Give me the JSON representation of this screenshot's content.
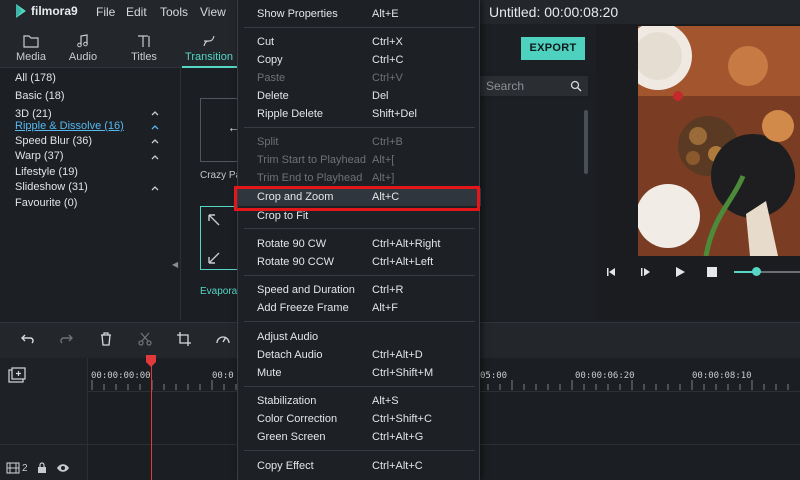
{
  "app": {
    "name": "filmora9",
    "project_title": "Untitled:",
    "project_time": "00:00:08:20"
  },
  "menubar": {
    "items": [
      "File",
      "Edit",
      "Tools",
      "View"
    ]
  },
  "tabs": [
    {
      "label": "Media",
      "icon": "folder-icon"
    },
    {
      "label": "Audio",
      "icon": "music-note-icon"
    },
    {
      "label": "Titles",
      "icon": "text-icon"
    },
    {
      "label": "Transition",
      "icon": "transition-icon"
    }
  ],
  "categories": [
    {
      "label": "All (178)",
      "caret": false
    },
    {
      "label": "Basic (18)",
      "caret": false
    },
    {
      "label": "3D (21)",
      "caret": true
    },
    {
      "label": "Ripple & Dissolve (16)",
      "caret": true,
      "active": true
    },
    {
      "label": "Speed Blur (36)",
      "caret": true
    },
    {
      "label": "Warp (37)",
      "caret": true
    },
    {
      "label": "Lifestyle (19)",
      "caret": false
    },
    {
      "label": "Slideshow (31)",
      "caret": true
    },
    {
      "label": "Favourite (0)",
      "caret": false
    }
  ],
  "thumbnails": [
    {
      "label": "Crazy Pa"
    },
    {
      "label": "Evapora"
    }
  ],
  "export_label": "EXPORT",
  "search": {
    "placeholder": "Search"
  },
  "timeline": {
    "timecodes": [
      "00:00:00:00",
      "00:0",
      "05:00",
      "00:00:06:20",
      "00:00:08:10"
    ],
    "track_count": "2"
  },
  "context_menu": [
    {
      "label": "Show Properties",
      "shortcut": "Alt+E",
      "enabled": true
    },
    {
      "label": "Cut",
      "shortcut": "Ctrl+X",
      "enabled": true
    },
    {
      "label": "Copy",
      "shortcut": "Ctrl+C",
      "enabled": true
    },
    {
      "label": "Paste",
      "shortcut": "Ctrl+V",
      "enabled": false
    },
    {
      "label": "Delete",
      "shortcut": "Del",
      "enabled": true
    },
    {
      "label": "Ripple Delete",
      "shortcut": "Shift+Del",
      "enabled": true
    },
    {
      "label": "Split",
      "shortcut": "Ctrl+B",
      "enabled": false
    },
    {
      "label": "Trim Start to Playhead",
      "shortcut": "Alt+[",
      "enabled": false
    },
    {
      "label": "Trim End to Playhead",
      "shortcut": "Alt+]",
      "enabled": false
    },
    {
      "label": "Crop and Zoom",
      "shortcut": "Alt+C",
      "enabled": true,
      "highlighted": true
    },
    {
      "label": "Crop to Fit",
      "shortcut": "",
      "enabled": true
    },
    {
      "label": "Rotate 90 CW",
      "shortcut": "Ctrl+Alt+Right",
      "enabled": true
    },
    {
      "label": "Rotate 90 CCW",
      "shortcut": "Ctrl+Alt+Left",
      "enabled": true
    },
    {
      "label": "Speed and Duration",
      "shortcut": "Ctrl+R",
      "enabled": true
    },
    {
      "label": "Add Freeze Frame",
      "shortcut": "Alt+F",
      "enabled": true
    },
    {
      "label": "Adjust Audio",
      "shortcut": "",
      "enabled": true
    },
    {
      "label": "Detach Audio",
      "shortcut": "Ctrl+Alt+D",
      "enabled": true
    },
    {
      "label": "Mute",
      "shortcut": "Ctrl+Shift+M",
      "enabled": true
    },
    {
      "label": "Stabilization",
      "shortcut": "Alt+S",
      "enabled": true
    },
    {
      "label": "Color Correction",
      "shortcut": "Ctrl+Shift+C",
      "enabled": true
    },
    {
      "label": "Green Screen",
      "shortcut": "Ctrl+Alt+G",
      "enabled": true
    },
    {
      "label": "Copy Effect",
      "shortcut": "Ctrl+Alt+C",
      "enabled": true
    }
  ],
  "colors": {
    "accent": "#56d6c4",
    "highlight_box": "#e3171a",
    "playhead": "#e23a3a",
    "active_category": "#56b9f0"
  }
}
